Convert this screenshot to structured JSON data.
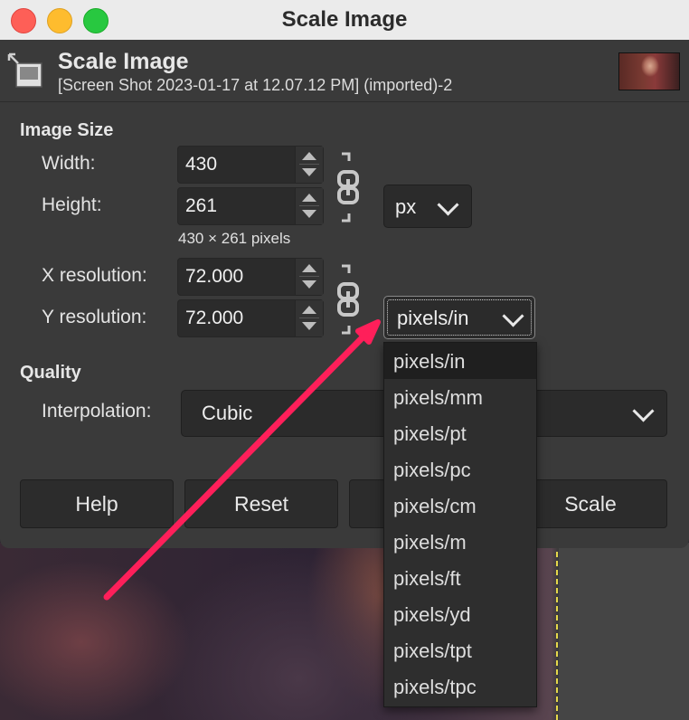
{
  "window": {
    "title": "Scale Image"
  },
  "header": {
    "title": "Scale Image",
    "subtitle": "[Screen Shot 2023-01-17 at 12.07.12 PM] (imported)-2",
    "icon": "scale-image-icon"
  },
  "image_size": {
    "label": "Image Size",
    "width_label": "Width:",
    "width_value": "430",
    "height_label": "Height:",
    "height_value": "261",
    "size_note": "430 × 261 pixels",
    "unit": "px",
    "x_res_label": "X resolution:",
    "x_res_value": "72.000",
    "y_res_label": "Y resolution:",
    "y_res_value": "72.000",
    "res_unit": "pixels/in"
  },
  "quality": {
    "label": "Quality",
    "interpolation_label": "Interpolation:",
    "interpolation_value": "Cubic"
  },
  "buttons": {
    "help": "Help",
    "reset": "Reset",
    "scale": "Scale"
  },
  "res_unit_options": [
    "pixels/in",
    "pixels/mm",
    "pixels/pt",
    "pixels/pc",
    "pixels/cm",
    "pixels/m",
    "pixels/ft",
    "pixels/yd",
    "pixels/tpt",
    "pixels/tpc"
  ],
  "colors": {
    "annotation_arrow": "#ff1f5a",
    "dialog_bg": "#3a3a3a"
  }
}
